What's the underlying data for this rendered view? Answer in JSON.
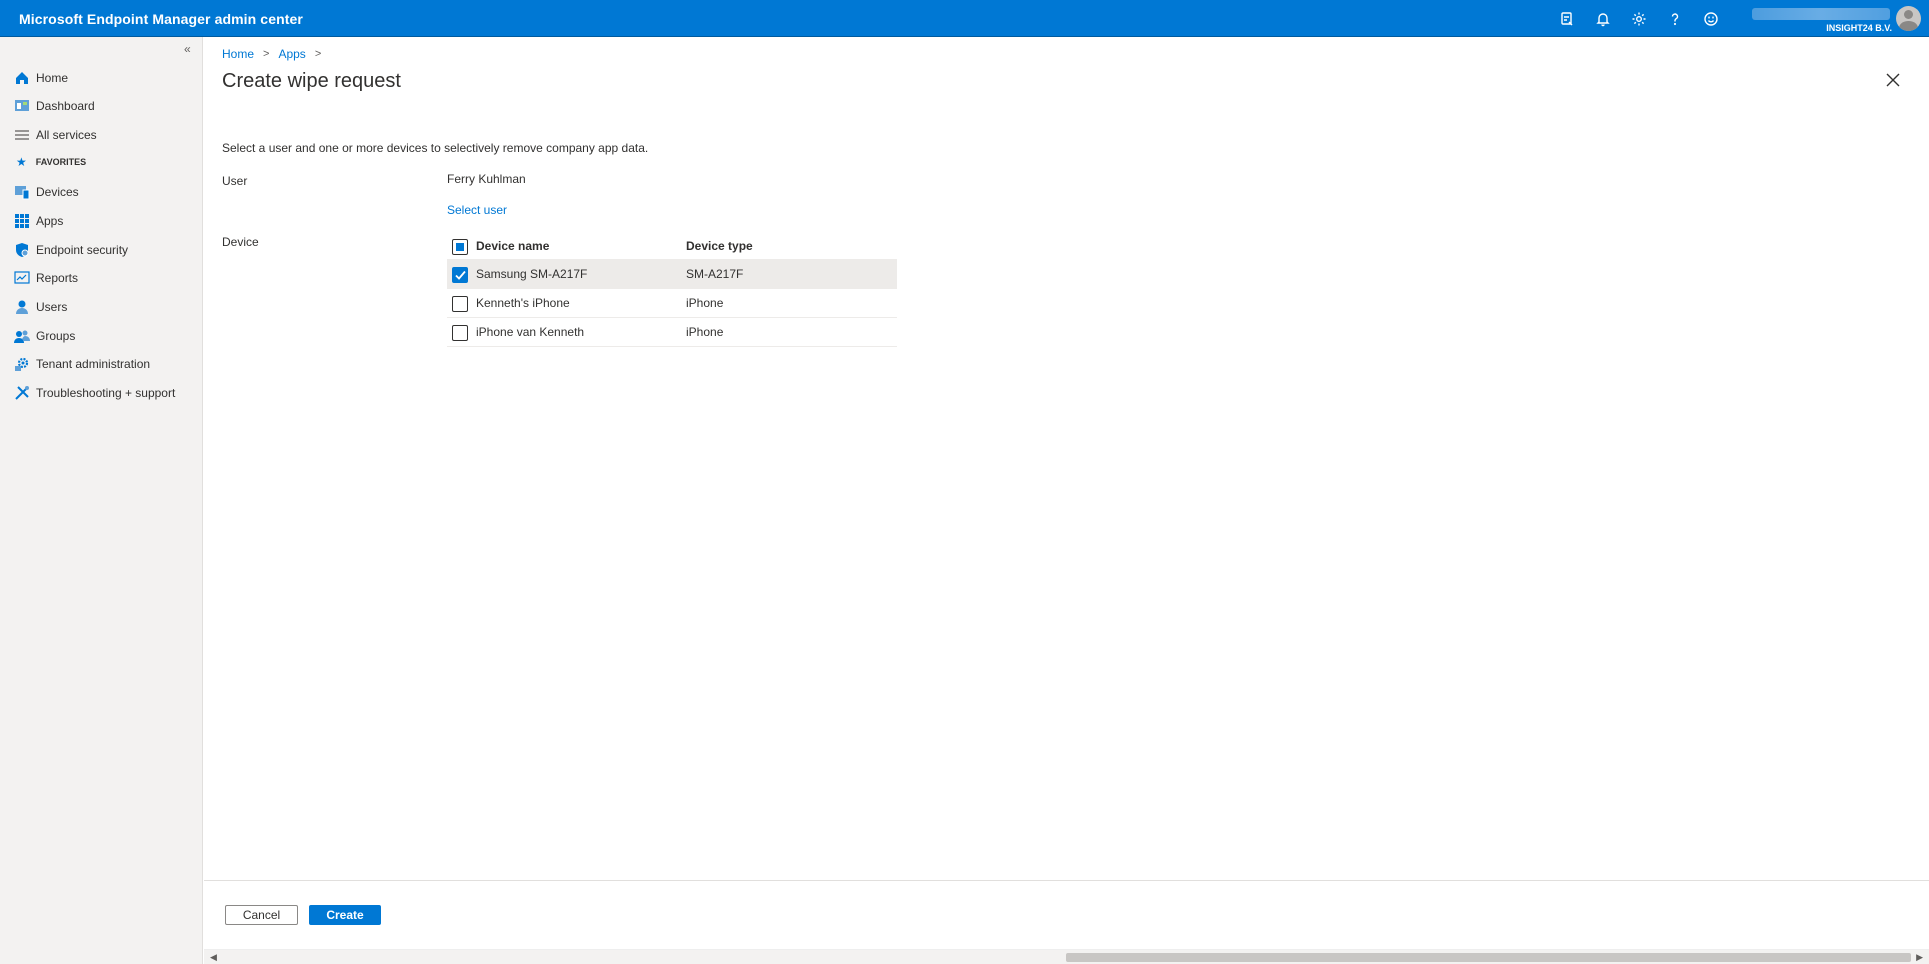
{
  "app": {
    "title": "Microsoft Endpoint Manager admin center",
    "tenant": "INSIGHT24 B.V."
  },
  "topbar": {
    "icons": [
      "feedback-device-icon",
      "bell-icon",
      "gear-icon",
      "help-icon",
      "smiley-icon"
    ]
  },
  "sidebar": {
    "collapse_glyph": "«",
    "favorites_label": "FAVORITES",
    "items": [
      {
        "label": "Home",
        "icon": "home-icon"
      },
      {
        "label": "Dashboard",
        "icon": "dashboard-icon"
      },
      {
        "label": "All services",
        "icon": "list-icon"
      },
      {
        "label": "Devices",
        "icon": "devices-icon"
      },
      {
        "label": "Apps",
        "icon": "apps-icon"
      },
      {
        "label": "Endpoint security",
        "icon": "shield-icon"
      },
      {
        "label": "Reports",
        "icon": "reports-icon"
      },
      {
        "label": "Users",
        "icon": "user-icon"
      },
      {
        "label": "Groups",
        "icon": "groups-icon"
      },
      {
        "label": "Tenant administration",
        "icon": "tenant-gear-icon"
      },
      {
        "label": "Troubleshooting + support",
        "icon": "tools-icon"
      }
    ]
  },
  "breadcrumb": {
    "home": "Home",
    "apps": "Apps",
    "sep": ">"
  },
  "page": {
    "title": "Create wipe request",
    "intro": "Select a user and one or more devices to selectively remove company app data.",
    "user_label": "User",
    "user_value": "Ferry Kuhlman",
    "select_user": "Select user",
    "device_label": "Device"
  },
  "device_table": {
    "columns": [
      "Device name",
      "Device type"
    ],
    "rows": [
      {
        "name": "Samsung SM-A217F",
        "type": "SM-A217F",
        "checked": true
      },
      {
        "name": "Kenneth's iPhone",
        "type": "iPhone",
        "checked": false
      },
      {
        "name": "iPhone van Kenneth",
        "type": "iPhone",
        "checked": false
      }
    ]
  },
  "footer": {
    "cancel": "Cancel",
    "create": "Create"
  },
  "colors": {
    "accent": "#0078d4",
    "sidebar_bg": "#f3f2f1"
  }
}
